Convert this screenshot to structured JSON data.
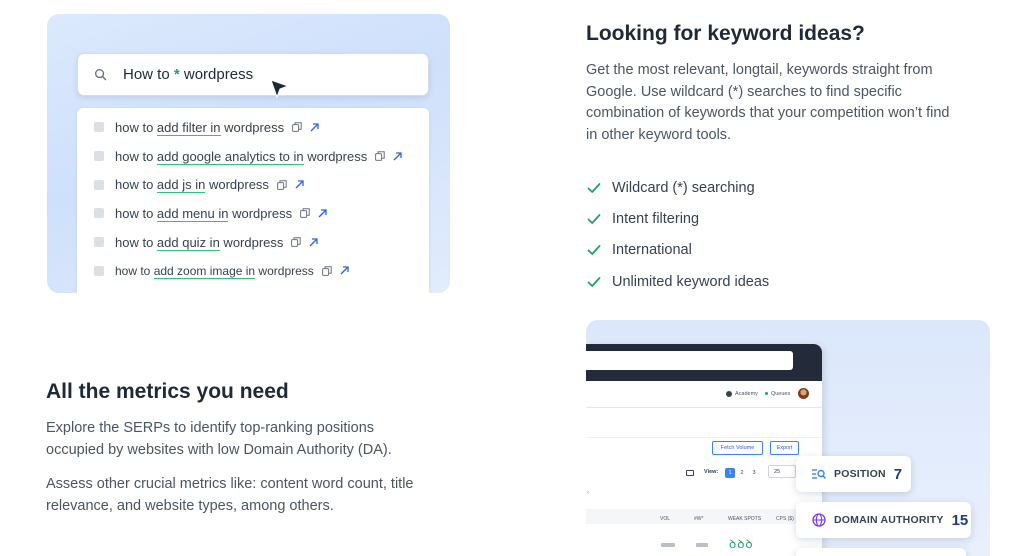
{
  "search_demo": {
    "query_prefix": "How to ",
    "wildcard": "*",
    "query_suffix": " wordpress",
    "results": [
      {
        "pre": "how to ",
        "hl": "add filter in",
        "post": " wordpress"
      },
      {
        "pre": "how to ",
        "hl": "add google analytics to in",
        "post": " wordpress"
      },
      {
        "pre": "how to ",
        "hl": "add js in",
        "post": " wordpress"
      },
      {
        "pre": "how to ",
        "hl": "add menu in",
        "post": " wordpress"
      },
      {
        "pre": "how to ",
        "hl": "add quiz in",
        "post": " wordpress"
      },
      {
        "pre": "how to ",
        "hl": "add zoom image in",
        "post": " wordpress"
      }
    ]
  },
  "keywords_section": {
    "title": "Looking for keyword ideas?",
    "paragraph_lines": [
      "Get the most relevant, longtail, keywords straight from",
      "Google. Use wildcard (*) searches to find specific",
      "combination of keywords that your competition won’t find",
      "in other keyword tools."
    ],
    "features": [
      "Wildcard (*) searching",
      "Intent filtering",
      "International",
      "Unlimited keyword ideas"
    ]
  },
  "metrics_section": {
    "title": "All the metrics you need",
    "paragraph1_lines": [
      "Explore the SERPs to identify top-ranking positions",
      "occupied by websites with low Domain Authority (DA)."
    ],
    "paragraph2_lines": [
      "Assess other crucial metrics like: content word count, title",
      "relevance, and website types, among others."
    ]
  },
  "app_preview": {
    "nav_academy": "Academy",
    "nav_queues": "Queues",
    "fetch_volume": "Fetch Volume",
    "export": "Export",
    "view_label": "View:",
    "pages": [
      "1",
      "2",
      "3"
    ],
    "per_page": "25",
    "columns": [
      "VOL",
      "#W°",
      "WEAK SPOTS",
      "CPS ($)"
    ],
    "weak_spots_glyph": "ꝺꝺꝺ"
  },
  "metric_pills": {
    "position_label": "POSITION",
    "position_value": "7",
    "da_label": "DOMAIN AUTHORITY",
    "da_value": "15"
  },
  "colors": {
    "accent_green": "#22a06b",
    "highlight_underline": "#34c17b",
    "link_blue": "#2563eb",
    "dark_navy": "#232a3a",
    "pill_value": "#1e3a8a"
  }
}
